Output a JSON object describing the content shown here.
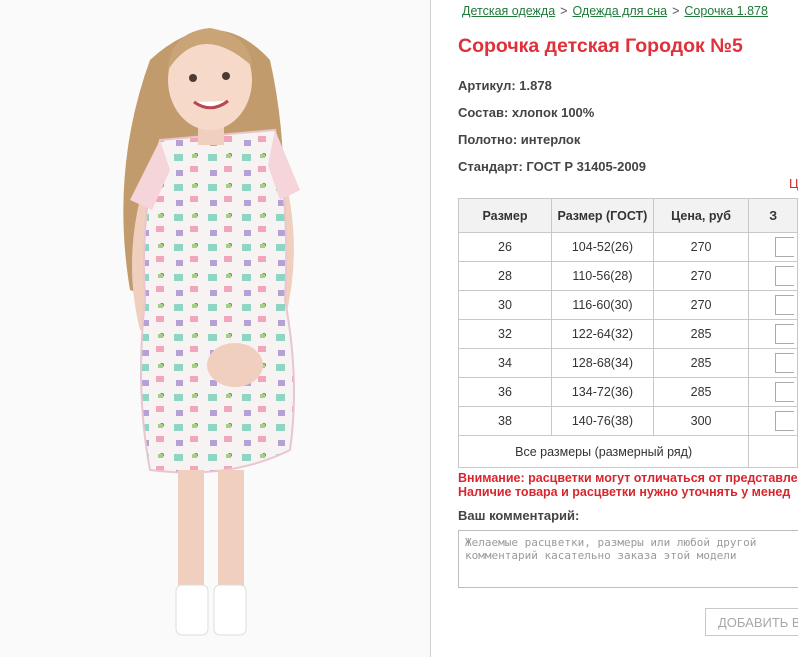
{
  "breadcrumb": [
    {
      "label": "Детская одежда"
    },
    {
      "label": "Одежда для сна"
    },
    {
      "label": "Сорочка 1.878"
    }
  ],
  "breadcrumb_separator": ">",
  "product": {
    "title": "Сорочка детская Городок №5",
    "specs": [
      "Артикул: 1.878",
      "Состав: хлопок 100%",
      "Полотно: интерлок",
      "Стандарт: ГОСТ Р 31405-2009"
    ],
    "cutoff_red_text": "Ц"
  },
  "size_table": {
    "headers": [
      "Размер",
      "Размер (ГОСТ)",
      "Цена, руб",
      "З"
    ],
    "rows": [
      [
        "26",
        "104-52(26)",
        "270"
      ],
      [
        "28",
        "110-56(28)",
        "270"
      ],
      [
        "30",
        "116-60(30)",
        "270"
      ],
      [
        "32",
        "122-64(32)",
        "285"
      ],
      [
        "34",
        "128-68(34)",
        "285"
      ],
      [
        "36",
        "134-72(36)",
        "285"
      ],
      [
        "38",
        "140-76(38)",
        "300"
      ]
    ],
    "all_sizes_label": "Все размеры (размерный ряд)"
  },
  "warnings": [
    "Внимание: расцветки могут отличаться от представле",
    "Наличие товара и расцветки нужно уточнять у менед"
  ],
  "comment": {
    "label": "Ваш комментарий:",
    "placeholder": "Желаемые расцветки, размеры или любой другой комментарий касательно заказа этой модели"
  },
  "add_button_label": "ДОБАВИТЬ В",
  "colors": {
    "accent_red": "#e0313a",
    "link_green": "#1f7a3a"
  }
}
